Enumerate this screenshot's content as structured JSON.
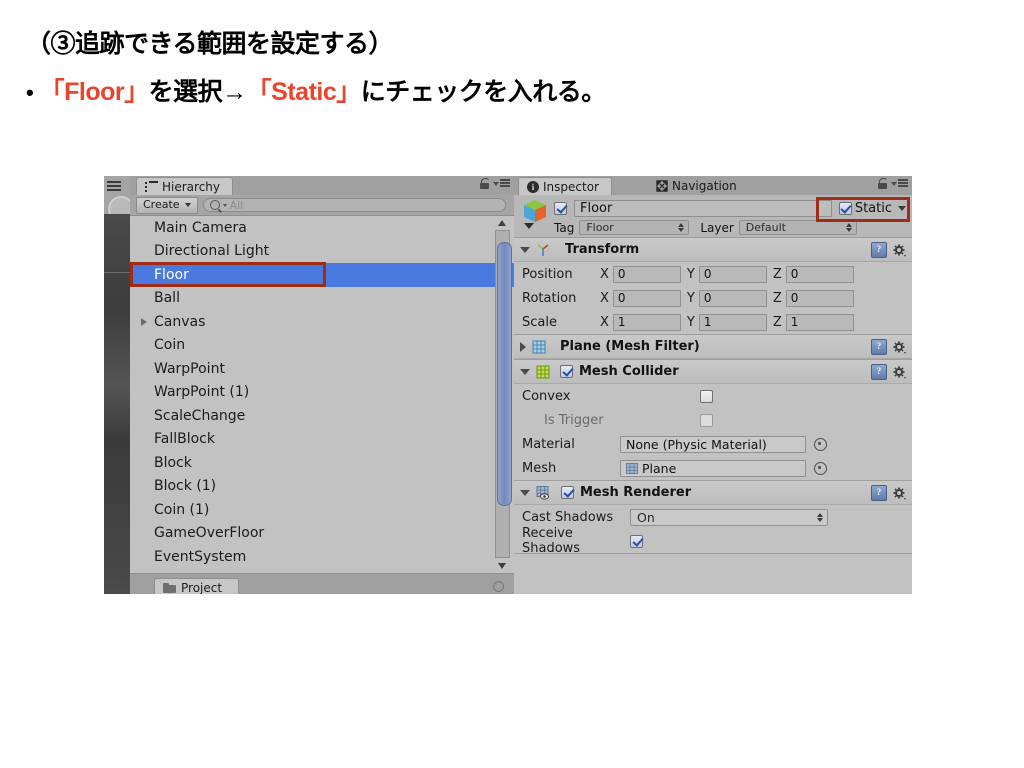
{
  "slide": {
    "line1": "（③追跡できる範囲を設定する）",
    "bullet": "•",
    "line2_part1": "「Floor」",
    "line2_part2": "を選択→",
    "line2_part3": "「Static」",
    "line2_part4": "にチェックを入れる。",
    "accent_color": "#e8452c"
  },
  "unity": {
    "hierarchy": {
      "tab_label": "Hierarchy",
      "tab_icon": "hierarchy-list-icon",
      "create_button": "Create",
      "search_placeholder": "All",
      "search_icon": "search-icon",
      "lock_icon": "lock-icon",
      "menu_icon": "panel-menu-icon",
      "items": [
        {
          "label": "Main Camera",
          "selected": false,
          "expandable": false
        },
        {
          "label": "Directional Light",
          "selected": false,
          "expandable": false
        },
        {
          "label": "Floor",
          "selected": true,
          "expandable": false
        },
        {
          "label": "Ball",
          "selected": false,
          "expandable": false
        },
        {
          "label": "Canvas",
          "selected": false,
          "expandable": true
        },
        {
          "label": "Coin",
          "selected": false,
          "expandable": false
        },
        {
          "label": "WarpPoint",
          "selected": false,
          "expandable": false
        },
        {
          "label": "WarpPoint (1)",
          "selected": false,
          "expandable": false
        },
        {
          "label": "ScaleChange",
          "selected": false,
          "expandable": false
        },
        {
          "label": "FallBlock",
          "selected": false,
          "expandable": false
        },
        {
          "label": "Block",
          "selected": false,
          "expandable": false
        },
        {
          "label": "Block (1)",
          "selected": false,
          "expandable": false
        },
        {
          "label": "Coin (1)",
          "selected": false,
          "expandable": false
        },
        {
          "label": "GameOverFloor",
          "selected": false,
          "expandable": false
        },
        {
          "label": "EventSystem",
          "selected": false,
          "expandable": false
        }
      ]
    },
    "project_tab": {
      "label": "Project",
      "icon": "folder-icon"
    },
    "inspector": {
      "tab_label": "Inspector",
      "tab_icon": "info-icon",
      "nav_tab_label": "Navigation",
      "nav_tab_icon": "navigation-icon",
      "lock_icon": "lock-icon",
      "menu_icon": "panel-menu-icon",
      "object": {
        "enabled": true,
        "name": "Floor",
        "static_label": "Static",
        "static_checked": true,
        "tag_label": "Tag",
        "tag_value": "Floor",
        "layer_label": "Layer",
        "layer_value": "Default"
      },
      "components": [
        {
          "name": "Transform",
          "expanded": true,
          "icon": "transform-axis-icon",
          "rows": [
            {
              "label": "Position",
              "x": "0",
              "y": "0",
              "z": "0"
            },
            {
              "label": "Rotation",
              "x": "0",
              "y": "0",
              "z": "0"
            },
            {
              "label": "Scale",
              "x": "1",
              "y": "1",
              "z": "1"
            }
          ],
          "axes": [
            "X",
            "Y",
            "Z"
          ]
        },
        {
          "name": "Plane (Mesh Filter)",
          "expanded": false,
          "icon": "mesh-filter-icon"
        },
        {
          "name": "Mesh Collider",
          "expanded": true,
          "enabled": true,
          "icon": "mesh-collider-icon",
          "fields": [
            {
              "label": "Convex",
              "type": "checkbox",
              "checked": false,
              "disabled": false
            },
            {
              "label": "Is Trigger",
              "type": "checkbox",
              "checked": false,
              "disabled": true
            },
            {
              "label": "Material",
              "type": "object",
              "value": "None (Physic Material)"
            },
            {
              "label": "Mesh",
              "type": "object",
              "value": "Plane",
              "has_icon": true
            }
          ]
        },
        {
          "name": "Mesh Renderer",
          "expanded": true,
          "enabled": true,
          "icon": "mesh-renderer-icon",
          "fields": [
            {
              "label": "Cast Shadows",
              "type": "dropdown",
              "value": "On"
            },
            {
              "label": "Receive Shadows",
              "type": "checkbox",
              "checked": true
            }
          ]
        }
      ],
      "help_icon": "help-book-icon",
      "gear_icon": "gear-icon"
    },
    "highlight_color": "#a02b17",
    "selection_color": "#4a7ae0"
  }
}
